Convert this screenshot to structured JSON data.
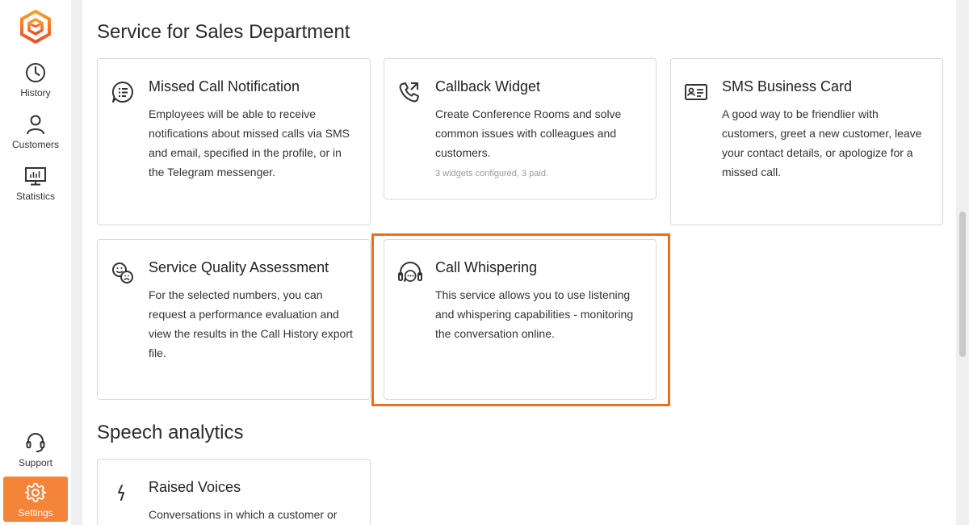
{
  "sidebar": {
    "logo_icon": "cube-logo-icon",
    "items": [
      {
        "label": "History",
        "icon": "clock-icon"
      },
      {
        "label": "Customers",
        "icon": "person-icon"
      },
      {
        "label": "Statistics",
        "icon": "monitor-chart-icon"
      },
      {
        "label": "Support",
        "icon": "headset-icon"
      },
      {
        "label": "Settings",
        "icon": "gear-icon",
        "active": true
      }
    ],
    "accent_color": "#f4843a"
  },
  "sections": [
    {
      "title": "Service for Sales Department",
      "cards": [
        {
          "title": "Missed Call Notification",
          "icon": "chat-lines-icon",
          "description": "Employees will be able to receive notifications about missed calls via SMS and email, specified in the profile, or in the Telegram messenger."
        },
        {
          "title": "Callback Widget",
          "icon": "phone-callback-icon",
          "description": "Create Conference Rooms and solve common issues with colleagues and customers.",
          "note": "3 widgets configured, 3 paid."
        },
        {
          "title": "SMS Business Card",
          "icon": "id-card-icon",
          "description": "A good way to be friendlier with customers, greet a new customer, leave your contact details, or apologize for a missed call."
        },
        {
          "title": "Service Quality Assessment",
          "icon": "smiley-faces-icon",
          "description": "For the selected numbers, you can request a performance evaluation and view the results in the Call History export file."
        },
        {
          "title": "Call Whispering",
          "icon": "headphones-chat-icon",
          "description": "This service allows you to use listening and whispering capabilities - monitoring the conversation online.",
          "highlighted": true
        }
      ]
    },
    {
      "title": "Speech analytics",
      "cards": [
        {
          "title": "Raised Voices",
          "icon": "lightning-icon",
          "description": "Conversations in which a customer or"
        }
      ]
    }
  ],
  "highlight_color": "#ef6e17"
}
